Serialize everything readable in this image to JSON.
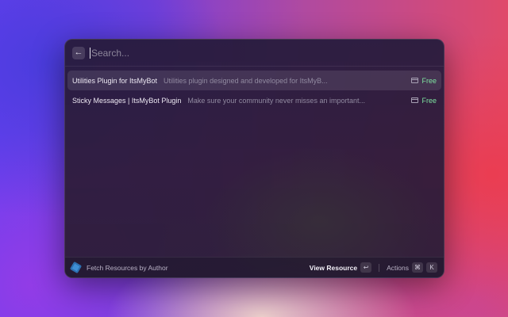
{
  "search": {
    "placeholder": "Search...",
    "value": ""
  },
  "results": [
    {
      "title": "Utilities Plugin for ItsMyBot",
      "subtitle": "Utilities plugin designed and developed for ItsMyB...",
      "accessory": "Free",
      "accessory_icon": "tag-icon",
      "selected": true
    },
    {
      "title": "Sticky Messages | ItsMyBot Plugin",
      "subtitle": "Make sure your community never misses an important...",
      "accessory": "Free",
      "accessory_icon": "tag-icon",
      "selected": false
    }
  ],
  "footer": {
    "command_label": "Fetch Resources by Author",
    "primary_action": "View Resource",
    "primary_shortcut": "↩",
    "actions_label": "Actions",
    "actions_shortcut_mod": "⌘",
    "actions_shortcut_key": "K"
  },
  "colors": {
    "accent_free": "#7ee3a0",
    "extension_icon": "#3f8fd6"
  },
  "icons": {
    "back": "arrow-left-icon",
    "extension": "extension-cube-icon"
  }
}
